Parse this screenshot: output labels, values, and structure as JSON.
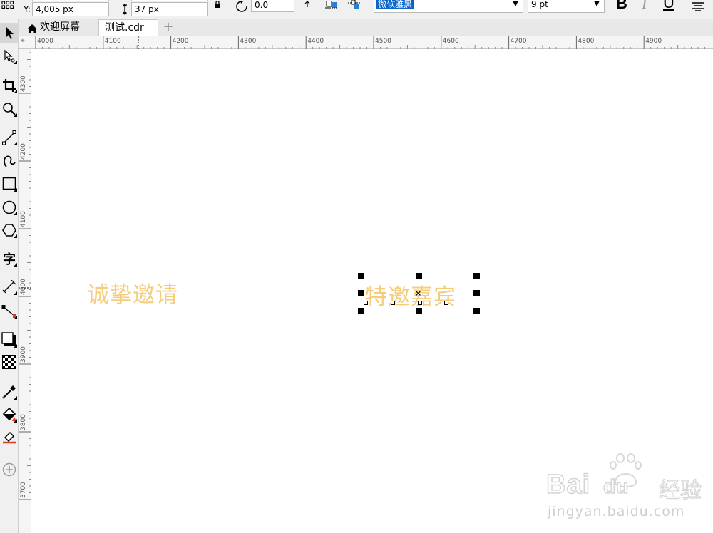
{
  "property_bar": {
    "y_label": "Y:",
    "y_value": "4,005 px",
    "height_value": "37 px",
    "rotation_value": "0.0",
    "font_name": "微软雅黑",
    "font_size": "9 pt",
    "bold": "B",
    "italic": "I",
    "underline": "U"
  },
  "tabs": [
    {
      "label": "欢迎屏幕",
      "icon": "home-icon"
    },
    {
      "label": "测试.cdr",
      "active": true
    }
  ],
  "new_tab_label": "+",
  "rulers": {
    "horizontal_ticks": [
      "4000",
      "4100",
      "4200",
      "4300",
      "4400",
      "4500",
      "4600",
      "4700",
      "4800",
      "4900"
    ],
    "vertical_ticks": [
      "4300",
      "4200",
      "4100",
      "4000",
      "3900",
      "3800",
      "3700"
    ],
    "units_glyph": "⌖"
  },
  "toolbox": [
    "pick-tool-icon",
    "shape-tool-icon",
    "crop-tool-icon",
    "zoom-tool-icon",
    "freehand-tool-icon",
    "artistic-media-icon",
    "rectangle-tool-icon",
    "ellipse-tool-icon",
    "polygon-tool-icon",
    "text-tool-icon",
    "parallel-dimension-icon",
    "connector-tool-icon",
    "drop-shadow-icon",
    "transparency-icon",
    "color-eyedropper-icon",
    "interactive-fill-icon",
    "smart-fill-icon",
    "add-tool-icon"
  ],
  "text_tool_glyph": "字",
  "canvas": {
    "text_1": "诚挚邀请",
    "text_2": "特邀嘉宾",
    "text_color": "#f5cc7a"
  },
  "watermark": {
    "brand": "Bai",
    "brand_suffix": "du",
    "brand_cn": "经验",
    "url": "jingyan.baidu.com"
  }
}
